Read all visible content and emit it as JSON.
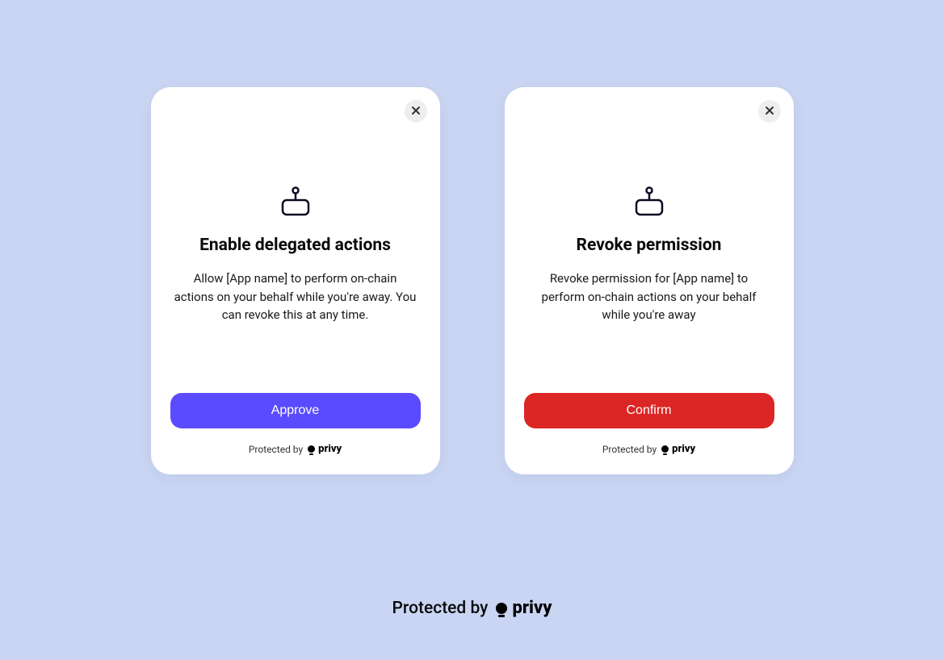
{
  "cards": {
    "enable": {
      "title": "Enable delegated actions",
      "description": "Allow [App name] to perform on-chain actions on your behalf while you're away. You can revoke this at any time.",
      "button_label": "Approve",
      "footer_label": "Protected by",
      "brand": "privy"
    },
    "revoke": {
      "title": "Revoke permission",
      "description": "Revoke permission for [App name] to perform on-chain actions on your behalf while you're away",
      "button_label": "Confirm",
      "footer_label": "Protected by",
      "brand": "privy"
    }
  },
  "page_footer": {
    "label": "Protected by",
    "brand": "privy"
  },
  "colors": {
    "background": "#c9d5f3",
    "approve_button": "#5b4bff",
    "confirm_button": "#dc2626"
  }
}
